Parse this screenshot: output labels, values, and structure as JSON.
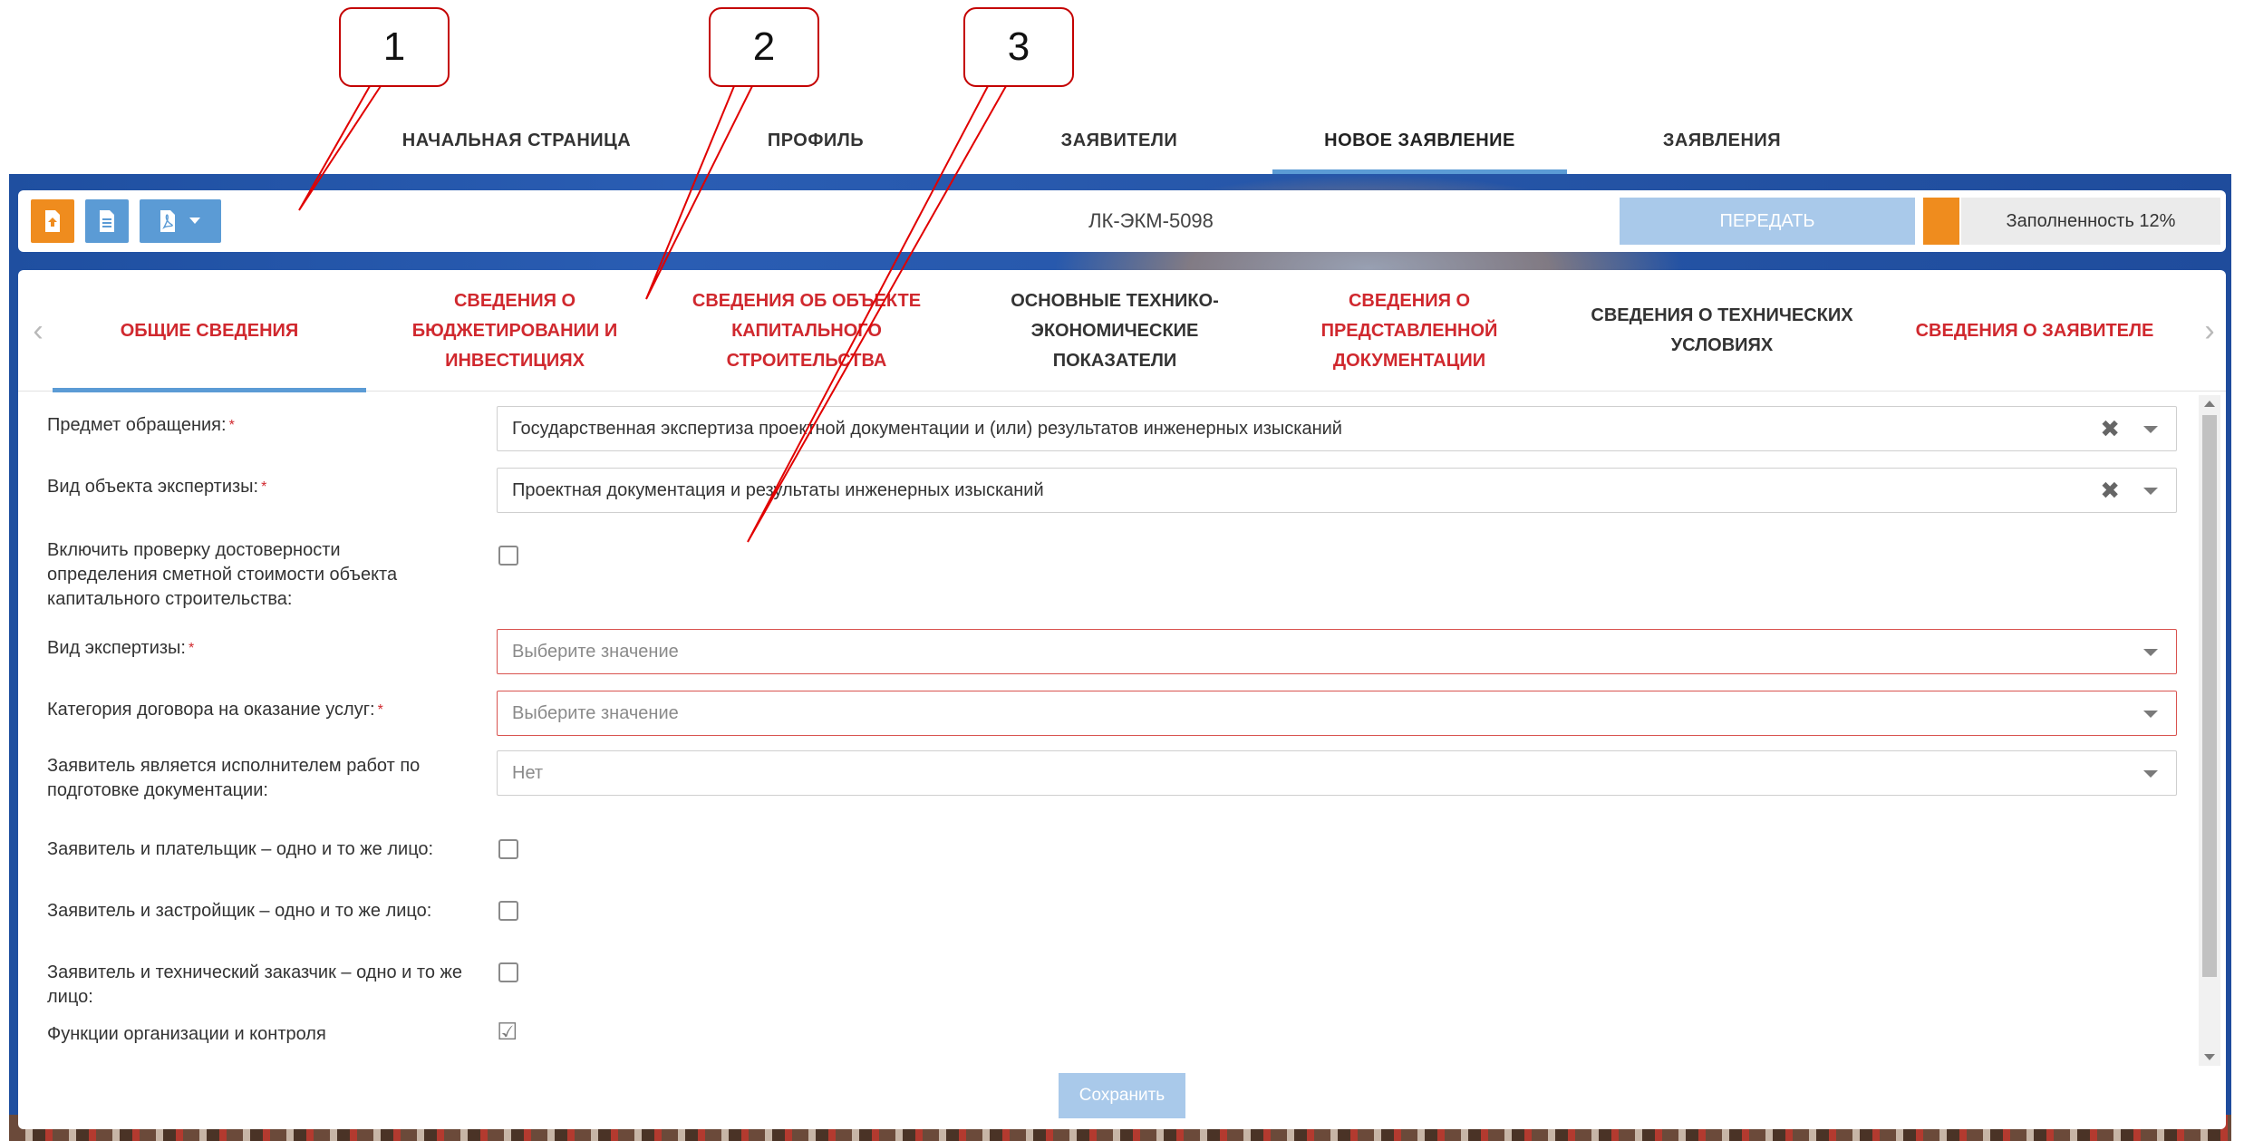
{
  "callouts": [
    "1",
    "2",
    "3"
  ],
  "nav": {
    "items": [
      "НАЧАЛЬНАЯ СТРАНИЦА",
      "ПРОФИЛЬ",
      "ЗАЯВИТЕЛИ",
      "НОВОЕ ЗАЯВЛЕНИЕ",
      "ЗАЯВЛЕНИЯ"
    ],
    "active": "НОВОЕ ЗАЯВЛЕНИЕ"
  },
  "toolbar": {
    "icons": [
      "upload-icon",
      "document-icon",
      "pdf-icon",
      "caret-down-icon"
    ],
    "doc_number": "ЛК-ЭКМ-5098",
    "send_label": "ПЕРЕДАТЬ",
    "fill_label": "Заполненность 12%",
    "fill_percent": 12
  },
  "tabs": [
    {
      "label": "ОБЩИЕ СВЕДЕНИЯ",
      "state": "active"
    },
    {
      "label": "СВЕДЕНИЯ О БЮДЖЕТИРОВАНИИ И ИНВЕСТИЦИЯХ",
      "state": "incomplete"
    },
    {
      "label": "СВЕДЕНИЯ ОБ ОБЪЕКТЕ КАПИТАЛЬНОГО СТРОИТЕЛЬСТВА",
      "state": "incomplete"
    },
    {
      "label": "ОСНОВНЫЕ ТЕХНИКО-ЭКОНОМИЧЕСКИЕ ПОКАЗАТЕЛИ",
      "state": "neutral"
    },
    {
      "label": "СВЕДЕНИЯ О ПРЕДСТАВЛЕННОЙ ДОКУМЕНТАЦИИ",
      "state": "incomplete"
    },
    {
      "label": "СВЕДЕНИЯ О ТЕХНИЧЕСКИХ УСЛОВИЯХ",
      "state": "neutral"
    },
    {
      "label": "СВЕДЕНИЯ О ЗАЯВИТЕЛЕ",
      "state": "incomplete"
    }
  ],
  "form": {
    "subject_label": "Предмет обращения:",
    "subject_value": "Государственная экспертиза проектной документации и (или) результатов инженерных изысканий",
    "object_type_label": "Вид объекта экспертизы:",
    "object_type_value": "Проектная документация и результаты инженерных изысканий",
    "cost_check_label": "Включить проверку достоверности определения сметной стоимости объекта капитального строительства:",
    "cost_check": false,
    "expertise_type_label": "Вид экспертизы:",
    "expertise_type_placeholder": "Выберите значение",
    "contract_category_label": "Категория договора на оказание услуг:",
    "contract_category_placeholder": "Выберите значение",
    "applicant_executor_label": "Заявитель является исполнителем работ по подготовке документации:",
    "applicant_executor_value": "Нет",
    "payer_same_label": "Заявитель и плательщик – одно и то же лицо:",
    "payer_same": false,
    "developer_same_label": "Заявитель и застройщик – одно и то же лицо:",
    "developer_same": false,
    "tech_customer_same_label": "Заявитель и технический заказчик – одно и то же лицо:",
    "tech_customer_same": false,
    "control_functions_label": "Функции организации и контроля",
    "control_functions": true,
    "required_mark": "*"
  },
  "save_label": "Сохранить",
  "colors": {
    "accent": "#5b9bd5",
    "orange": "#ef8c1e",
    "required_red": "#d0282e",
    "disabled_blue": "#a9c9ea"
  }
}
